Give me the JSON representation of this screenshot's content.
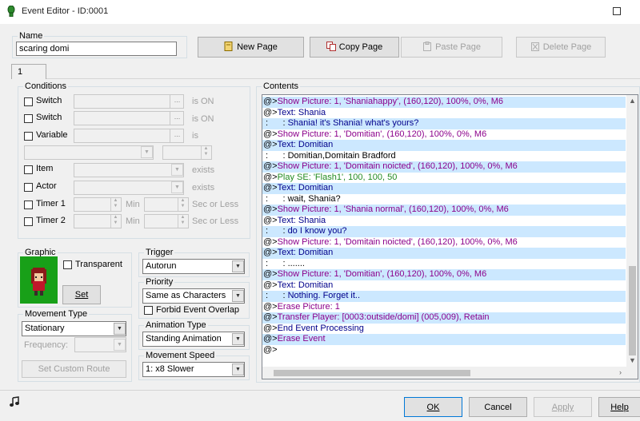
{
  "window": {
    "title": "Event Editor - ID:0001"
  },
  "name": {
    "label": "Name",
    "value": "scaring domi"
  },
  "toolbar": {
    "new_page": "New Page",
    "copy_page": "Copy Page",
    "paste_page": "Paste Page",
    "delete_page": "Delete Page"
  },
  "tabs": [
    "1"
  ],
  "conditions": {
    "label": "Conditions",
    "switch1": "Switch",
    "switch2": "Switch",
    "variable": "Variable",
    "is_on1": "is ON",
    "is_on2": "is ON",
    "is": "is",
    "item": "Item",
    "exists1": "exists",
    "actor": "Actor",
    "exists2": "exists",
    "timer1": "Timer 1",
    "timer2": "Timer 2",
    "min": "Min",
    "sec_or_less": "Sec or Less",
    "dots": "..."
  },
  "graphic": {
    "label": "Graphic",
    "transparent": "Transparent",
    "set": "Set"
  },
  "trigger": {
    "label": "Trigger",
    "value": "Autorun"
  },
  "priority": {
    "label": "Priority",
    "value": "Same as Characters",
    "forbid": "Forbid Event Overlap"
  },
  "movement_type": {
    "label": "Movement Type",
    "value": "Stationary",
    "frequency": "Frequency:",
    "set_route": "Set Custom Route"
  },
  "animation_type": {
    "label": "Animation Type",
    "value": "Standing Animation"
  },
  "movement_speed": {
    "label": "Movement Speed",
    "value": "1: x8 Slower"
  },
  "contents": {
    "label": "Contents",
    "rows": [
      {
        "a": "@>",
        "t": "Show Picture: 1, 'Shaniahappy', (160,120), 100%, 0%, M6",
        "k": "cmd"
      },
      {
        "a": "@>",
        "t": "Text: Shania",
        "k": "txt"
      },
      {
        "a": " :      : ",
        "t": "Shania! it's Shania! what's yours?",
        "k": "txt"
      },
      {
        "a": "@>",
        "t": "Show Picture: 1, 'Domitian', (160,120), 100%, 0%, M6",
        "k": "cmd"
      },
      {
        "a": "@>",
        "t": "Text: Domitian",
        "k": "txt"
      },
      {
        "a": " :      : ",
        "t": "Domitian,Domitain Bradford",
        "k": "at"
      },
      {
        "a": "@>",
        "t": "Show Picture: 1, 'Domitain noicted', (160,120), 100%, 0%, M6",
        "k": "cmd"
      },
      {
        "a": "@>",
        "t": "Play SE: 'Flash1', 100, 100, 50",
        "k": "se"
      },
      {
        "a": "@>",
        "t": "Text: Domitian",
        "k": "txt"
      },
      {
        "a": " :      : ",
        "t": "wait, Shania?",
        "k": "at"
      },
      {
        "a": "@>",
        "t": "Show Picture: 1, 'Shania normal', (160,120), 100%, 0%, M6",
        "k": "cmd"
      },
      {
        "a": "@>",
        "t": "Text: Shania",
        "k": "txt"
      },
      {
        "a": " :      : ",
        "t": "do I know you?",
        "k": "txt"
      },
      {
        "a": "@>",
        "t": "Show Picture: 1, 'Domitain noicted', (160,120), 100%, 0%, M6",
        "k": "cmd"
      },
      {
        "a": "@>",
        "t": "Text: Domitian",
        "k": "txt"
      },
      {
        "a": " :      : ",
        "t": ".......",
        "k": "at"
      },
      {
        "a": "@>",
        "t": "Show Picture: 1, 'Domitian', (160,120), 100%, 0%, M6",
        "k": "cmd"
      },
      {
        "a": "@>",
        "t": "Text: Domitian",
        "k": "txt"
      },
      {
        "a": " :      : ",
        "t": "Nothing. Forget it..",
        "k": "txt"
      },
      {
        "a": "@>",
        "t": "Erase Picture: 1",
        "k": "cmd"
      },
      {
        "a": "@>",
        "t": "Transfer Player: [0003:outside/domi] (005,009), Retain",
        "k": "cmd"
      },
      {
        "a": "@>",
        "t": "End Event Processing",
        "k": "txt"
      },
      {
        "a": "@>",
        "t": "Erase Event",
        "k": "cmd"
      },
      {
        "a": "@>",
        "t": "",
        "k": "at"
      }
    ]
  },
  "footer": {
    "ok": "OK",
    "cancel": "Cancel",
    "apply": "Apply",
    "help": "Help"
  },
  "colors": {
    "command": "#8b008b",
    "text": "#00008b",
    "sound": "#228b22",
    "selection": "#cce8ff"
  },
  "icons": [
    "event-icon",
    "music-note-icon"
  ]
}
